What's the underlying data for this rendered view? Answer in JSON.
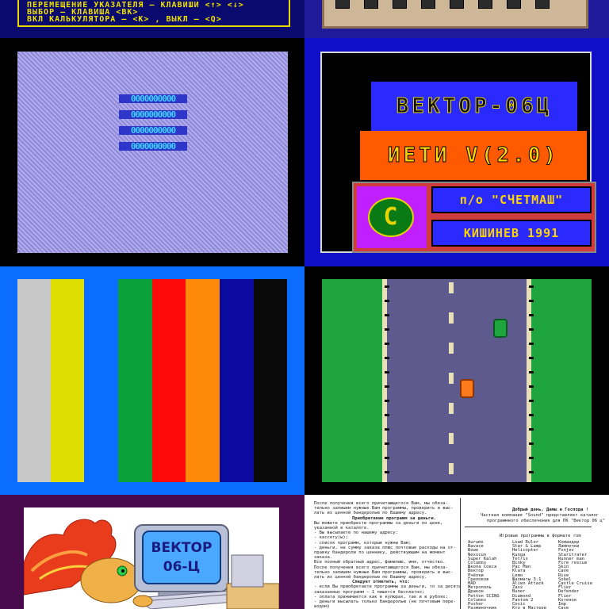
{
  "menu": {
    "lines": [
      "ПЕРЕМЕЩЕНИЕ УКАЗАТЕЛЯ — КЛАВИШИ <↑> <↓>",
      "ВЫБОР — КЛАВИША <ВК>",
      "ВКЛ КАЛЬКУЛЯТОРА — <К> , ВЫКЛ — <Q>"
    ]
  },
  "pattern_screen": {
    "rows": [
      "0000000000",
      "0000000000",
      "0000000000",
      "0000000000"
    ]
  },
  "title_screen": {
    "line1": "ВЕКТОР-06Ц",
    "line2": "ИЕТИ V(2.0)",
    "line3": "п/о \"СЧЕТМАШ\"",
    "line4": "КИШИНЕВ 1991",
    "logo_letter": "С"
  },
  "color_bars": {
    "colors": [
      "#c8c8c8",
      "#dede00",
      "#0a6dff",
      "#0aa03a",
      "#ff0a0a",
      "#ff8a0a",
      "#0a0aa0",
      "#0a0a0a"
    ]
  },
  "road_game": {
    "colors": {
      "grass": "#1fa53e",
      "road": "#5e5a8e",
      "car_green": "#1fa53e",
      "car_orange": "#ff7a1a"
    }
  },
  "cartoon": {
    "screen_text_1": "ВЕКТОР",
    "screen_text_2": "06-Ц"
  },
  "document": {
    "left_col": [
      "После получения всего причитающегося Вам, мы обяза-",
      "тельно запишем нужные Вам программы, проверить и выс-",
      "лать их ценной бандеролью по Вашему адресу.",
      "Приобретение программ за деньги.",
      "Вы можете приобрести программы за деньги по цене,",
      "указанной в каталоге.",
      " - Вы высылаете по нашему адресу:",
      " - кассету(ы);",
      " - список программ, которые нужны Вам;",
      " - деньги, на сумму заказа плюс почтовые расходы на от-",
      "   правку бандероли по ценнику, действующим на момент",
      "   заказа.",
      "Все полный обратный адрес, фамилию, имя, отчество.",
      "После получения всего причитающегося Вам, мы обяза-",
      "тельно запишем нужные Вам программы, проверить и выс-",
      "лать их ценной бандеролью по Вашему адресу.",
      "Следует отметить, что:",
      " - если Вы приобретаете программы за деньги, то за десять",
      "   заказанных программ — 1 пишется бесплатно;",
      " - оплата принимается как в купюрах, так и в рублях;",
      " - деньги высылать только бандеролью (не почтовым пере-",
      "   водом)"
    ],
    "right_header": [
      "Добрый день, Дамы и Господа !",
      "Частная компания \"Sound\" представляет каталог",
      "программного обеспечения для ПК \"Вектор 06 ц\""
    ],
    "right_sub": "Игровые программы в формате rom",
    "col_a": [
      "Aurums",
      "Bavace",
      "Bowe",
      "Nexxcun",
      "Super Kalah",
      "Columns",
      "Школа Сокса",
      "Вектор",
      "Пчёлки",
      "Грелоков",
      "HAD",
      "Метрополь",
      "Дракон",
      "Fetton SCING",
      "Columns",
      "Pusher",
      "Разминочник"
    ],
    "col_b": [
      "Load Ruler",
      "Star & Lamp",
      "Helicopter",
      "Kunga",
      "Tetris",
      "Binky",
      "Pac Man",
      "Klara",
      "Lemo",
      "Шахматы 3.1",
      "Alien Attack",
      "Zaxx",
      "Buner",
      "Diamond",
      "Fantom 2",
      "Cosic",
      "Кто в Мастере"
    ],
    "col_c": [
      "Командер",
      "Лампочки",
      "Fonjev",
      "Staritrater",
      "Runner man",
      "Fire rescue",
      "Skin",
      "Cave",
      "Rive",
      "Sobel",
      "Castle Cruise",
      "Flier",
      "Defender",
      "Flier",
      "Котенок",
      "Imp",
      "Cave"
    ]
  }
}
